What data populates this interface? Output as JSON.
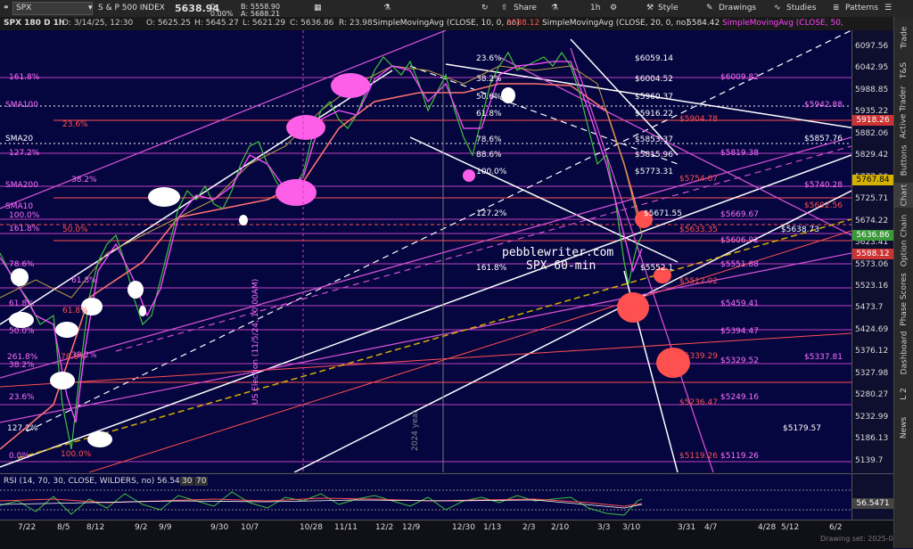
{
  "toolbar": {
    "symbol": "SPX",
    "name": "S & P 500 INDEX",
    "last": "5638.94",
    "change": "0",
    "change_pct": "0.00%",
    "bid_label": "B:",
    "bid": "5558.90",
    "ask_label": "A:",
    "ask": "5688.21",
    "share": "Share",
    "timeframe": "1h",
    "style": "Style",
    "drawings": "Drawings",
    "studies": "Studies",
    "patterns": "Patterns"
  },
  "header": {
    "chart_label": "SPX 180 D 1h",
    "date": "D: 3/14/25, 12:30",
    "open": "O: 5625.25",
    "high": "H: 5645.27",
    "low": "L: 5621.29",
    "close": "C: 5636.86",
    "range": "R: 23.98",
    "sma10_label": "SimpleMovingAvg (CLOSE, 10, 0, no)",
    "sma10_value": "5588.12",
    "sma20_label": "SimpleMovingAvg (CLOSE, 20, 0, no)",
    "sma20_value": "5584.42",
    "sma50_label": "SimpleMovingAvg (CLOSE, 50,"
  },
  "right_tabs": [
    "Trade",
    "T&S",
    "Active Trader",
    "Buttons",
    "Chart",
    "Option Chain",
    "Phase Scores",
    "Dashboard",
    "L 2",
    "News"
  ],
  "price_axis": {
    "labels": [
      "6097.56",
      "6042.95",
      "5988.85",
      "5935.22",
      "5882.06",
      "5829.42",
      "5777.30",
      "5725.71",
      "5674.22",
      "5623.41",
      "5573.06",
      "5523.16",
      "5473.7",
      "5424.69",
      "5376.12",
      "5327.98",
      "5280.27",
      "5232.99",
      "5186.13",
      "5139.7"
    ],
    "tags": [
      {
        "value": "5918.26",
        "color": "#cc3333"
      },
      {
        "value": "5767.84",
        "color": "#d4b000"
      },
      {
        "value": "5636.86",
        "color": "#3a9a3a"
      },
      {
        "value": "5588.12",
        "color": "#cc3333"
      }
    ]
  },
  "annotations": {
    "watermark_site": "pebblewriter.com",
    "watermark_chart": "SPX 60-min",
    "election": "US Election (11/5/24, 10:00AM)",
    "year": "2024 year",
    "fib_left": [
      "161.8%",
      "127.2%",
      "38.2%",
      "100.0%",
      "161.8%",
      "78.6%",
      "61.8%",
      "61.8%",
      "50.0%",
      "38.2%",
      "261.8%",
      "38.2%",
      "23.6%",
      "127.2%",
      "0.0%",
      "23.6%",
      "50.0%",
      "61.8%",
      "100.0%",
      "78.6%"
    ],
    "sma_labels": [
      "SMA100",
      "SMA20",
      "SMA200",
      "SMA10"
    ],
    "fib_mid": [
      "23.6%",
      "38.2%",
      "50.0%",
      "61.8%",
      "78.6%",
      "88.6%",
      "100.0%",
      "127.2%",
      "161.8%"
    ],
    "levels": [
      "$6059.14",
      "$6004.52",
      "$5960.37",
      "$5916.22",
      "$5853.37",
      "$5815.96",
      "$5773.31",
      "$5671.55",
      "$5552.1",
      "$6009.82",
      "$5904.78",
      "$5819.38",
      "$5754.67",
      "$5669.67",
      "$5633.35",
      "$5606.92",
      "$5551.88",
      "$5512.02",
      "$5459.41",
      "$5394.47",
      "$5339.29",
      "$5329.52",
      "$5249.16",
      "$5236.47",
      "$5119.26",
      "$5119.26",
      "$5942.88",
      "$5857.76",
      "$5740.28",
      "$5692.56",
      "$5638.73",
      "$5337.81",
      "$5179.57"
    ]
  },
  "rsi": {
    "label": "RSI (14, 70, 30, CLOSE, WILDERS, no)",
    "value": "56.5471",
    "upper": "30",
    "lower": "70",
    "axis_value": "56.5471"
  },
  "x_axis": [
    "7/22",
    "8/5",
    "8/12",
    "9/2",
    "9/9",
    "9/30",
    "10/7",
    "10/28",
    "11/11",
    "12/2",
    "12/9",
    "12/30",
    "1/13",
    "2/3",
    "2/10",
    "3/3",
    "3/10",
    "3/31",
    "4/7",
    "4/28",
    "5/12",
    "6/2"
  ],
  "footer": {
    "drawing_set": "Drawing set: 2025-03-1"
  },
  "colors": {
    "background": "#050540",
    "magenta": "#ff40ff",
    "salmon": "#ff5050",
    "white": "#ffffff",
    "gold": "#d4b000"
  }
}
